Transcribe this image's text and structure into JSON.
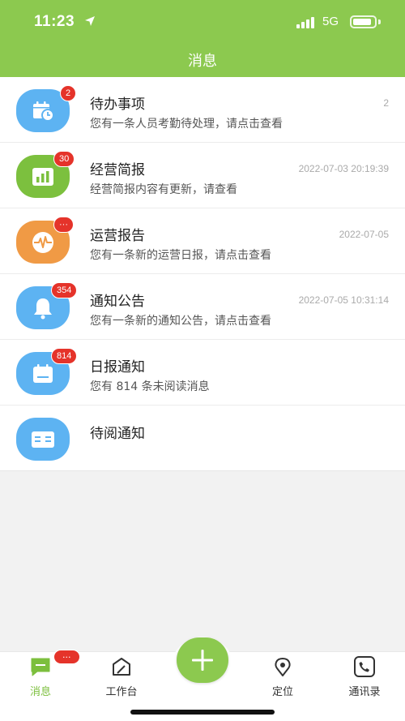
{
  "status_bar": {
    "time": "11:23",
    "network": "5G"
  },
  "header": {
    "title": "消息"
  },
  "messages": [
    {
      "title": "待办事项",
      "subtitle": "您有一条人员考勤待处理，请点击查看",
      "time": "2",
      "badge": "2",
      "icon": "calendar-clock-icon",
      "color": "#5db3f2"
    },
    {
      "title": "经营简报",
      "subtitle": "经营简报内容有更新，请查看",
      "time": "2022-07-03 20:19:39",
      "badge": "30",
      "icon": "bar-chart-icon",
      "color": "#7cc03e"
    },
    {
      "title": "运营报告",
      "subtitle": "您有一条新的运营日报，请点击查看",
      "time": "2022-07-05",
      "badge": "···",
      "icon": "pulse-icon",
      "color": "#f09a45"
    },
    {
      "title": "通知公告",
      "subtitle": "您有一条新的通知公告，请点击查看",
      "time": "2022-07-05 10:31:14",
      "badge": "354",
      "icon": "bell-icon",
      "color": "#5db3f2"
    },
    {
      "title": "日报通知",
      "subtitle": "您有 814 条未阅读消息",
      "time": "",
      "badge": "814",
      "icon": "calendar-icon",
      "color": "#5db3f2"
    },
    {
      "title": "待阅通知",
      "subtitle": "",
      "time": "",
      "badge": "",
      "icon": "book-icon",
      "color": "#5db3f2"
    }
  ],
  "tabbar": {
    "tabs": [
      {
        "label": "消息",
        "icon": "message-icon",
        "active": true,
        "badge": "···"
      },
      {
        "label": "工作台",
        "icon": "workbench-icon",
        "active": false
      },
      {
        "label": "定位",
        "icon": "location-icon",
        "active": false
      },
      {
        "label": "通讯录",
        "icon": "phone-icon",
        "active": false
      }
    ],
    "center_button_icon": "plus-icon"
  },
  "colors": {
    "brand_green": "#8cc94f",
    "badge_red": "#e5332a",
    "icon_blue": "#5db3f2",
    "icon_orange": "#f09a45"
  }
}
